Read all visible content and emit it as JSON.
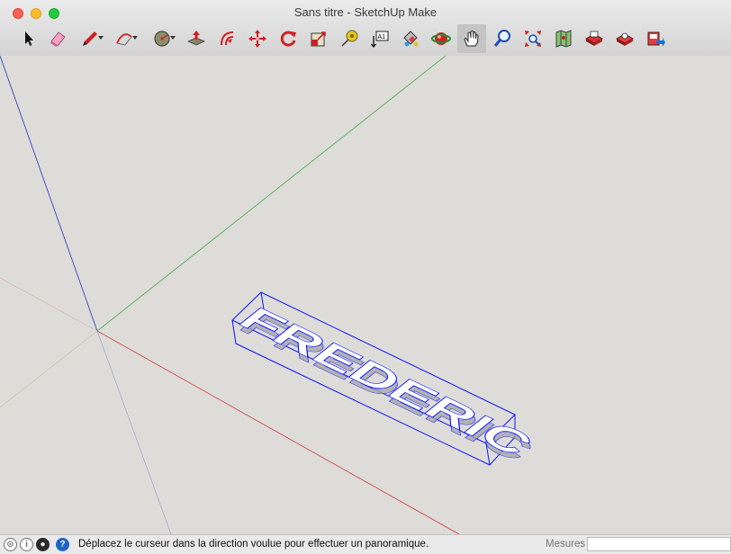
{
  "window": {
    "title": "Sans titre - SketchUp Make"
  },
  "toolbar": {
    "tools": [
      {
        "name": "select-tool",
        "icon": "arrow-cursor-icon"
      },
      {
        "name": "eraser-tool",
        "icon": "eraser-icon"
      },
      {
        "name": "line-tool",
        "icon": "pencil-icon",
        "has_dropdown": true
      },
      {
        "name": "arc-tool",
        "icon": "arc-icon",
        "has_dropdown": true
      },
      {
        "name": "shapes-tool",
        "icon": "circle-icon",
        "has_dropdown": true
      },
      {
        "name": "push-pull-tool",
        "icon": "push-pull-icon"
      },
      {
        "name": "offset-tool",
        "icon": "offset-icon"
      },
      {
        "name": "move-tool",
        "icon": "move-icon"
      },
      {
        "name": "rotate-tool",
        "icon": "rotate-icon"
      },
      {
        "name": "scale-tool",
        "icon": "scale-icon"
      },
      {
        "name": "tape-measure-tool",
        "icon": "tape-measure-icon"
      },
      {
        "name": "text-tool",
        "icon": "text-label-icon",
        "label": "A1"
      },
      {
        "name": "paint-bucket-tool",
        "icon": "paint-bucket-icon"
      },
      {
        "name": "orbit-tool",
        "icon": "orbit-icon"
      },
      {
        "name": "pan-tool",
        "icon": "hand-icon",
        "active": true
      },
      {
        "name": "zoom-tool",
        "icon": "magnifier-icon"
      },
      {
        "name": "zoom-extents-tool",
        "icon": "zoom-extents-icon"
      },
      {
        "name": "warehouse-tool",
        "icon": "map-icon"
      },
      {
        "name": "component-warehouse-tool",
        "icon": "warehouse-icon"
      },
      {
        "name": "extension-warehouse-tool",
        "icon": "extension-icon"
      },
      {
        "name": "share-model-tool",
        "icon": "share-icon"
      },
      {
        "name": "upload-tool",
        "icon": "upload-icon"
      }
    ]
  },
  "model": {
    "text": "FREDERIC"
  },
  "colors": {
    "axis_red": "#d24b4b",
    "axis_green": "#4caf50",
    "axis_blue": "#3344cc",
    "selection": "#0a14ff",
    "viewport_bg": "#dedcd8"
  },
  "statusbar": {
    "message": "Déplacez le curseur dans la direction voulue pour effectuer un panoramique.",
    "measure_label": "Mesures",
    "measure_value": ""
  }
}
